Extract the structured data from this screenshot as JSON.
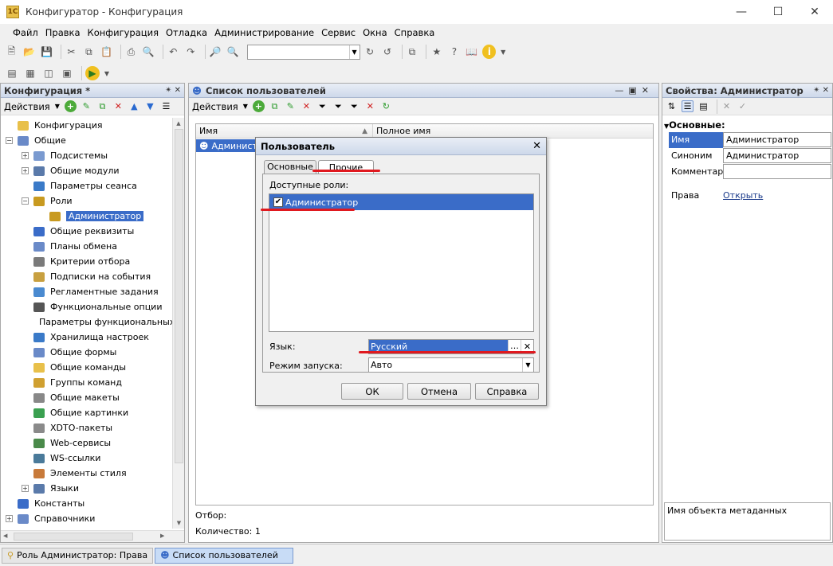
{
  "window": {
    "title": "Конфигуратор - Конфигурация"
  },
  "menu": [
    "Файл",
    "Правка",
    "Конфигурация",
    "Отладка",
    "Администрирование",
    "Сервис",
    "Окна",
    "Справка"
  ],
  "config_panel": {
    "title": "Конфигурация *",
    "actions_label": "Действия",
    "tree": [
      {
        "label": "Конфигурация",
        "level": 0,
        "icon": "config-icon"
      },
      {
        "label": "Общие",
        "level": 0,
        "icon": "common-icon",
        "expander": "−"
      },
      {
        "label": "Подсистемы",
        "level": 1,
        "icon": "subsystems-icon",
        "expander": "+"
      },
      {
        "label": "Общие модули",
        "level": 1,
        "icon": "modules-icon",
        "expander": "+"
      },
      {
        "label": "Параметры сеанса",
        "level": 1,
        "icon": "session-params-icon"
      },
      {
        "label": "Роли",
        "level": 1,
        "icon": "roles-icon",
        "expander": "−"
      },
      {
        "label": "Администратор",
        "level": 2,
        "icon": "role-icon",
        "selected": true
      },
      {
        "label": "Общие реквизиты",
        "level": 1,
        "icon": "attributes-icon"
      },
      {
        "label": "Планы обмена",
        "level": 1,
        "icon": "exchange-icon"
      },
      {
        "label": "Критерии отбора",
        "level": 1,
        "icon": "filter-icon"
      },
      {
        "label": "Подписки на события",
        "level": 1,
        "icon": "subscriptions-icon"
      },
      {
        "label": "Регламентные задания",
        "level": 1,
        "icon": "jobs-icon"
      },
      {
        "label": "Функциональные опции",
        "level": 1,
        "icon": "options-icon"
      },
      {
        "label": "Параметры функциональных",
        "level": 1,
        "icon": "option-params-icon"
      },
      {
        "label": "Хранилища настроек",
        "level": 1,
        "icon": "storage-icon"
      },
      {
        "label": "Общие формы",
        "level": 1,
        "icon": "forms-icon"
      },
      {
        "label": "Общие команды",
        "level": 1,
        "icon": "commands-icon"
      },
      {
        "label": "Группы команд",
        "level": 1,
        "icon": "command-groups-icon"
      },
      {
        "label": "Общие макеты",
        "level": 1,
        "icon": "templates-icon"
      },
      {
        "label": "Общие картинки",
        "level": 1,
        "icon": "pictures-icon"
      },
      {
        "label": "XDTO-пакеты",
        "level": 1,
        "icon": "xdto-icon"
      },
      {
        "label": "Web-сервисы",
        "level": 1,
        "icon": "web-services-icon"
      },
      {
        "label": "WS-ссылки",
        "level": 1,
        "icon": "ws-links-icon"
      },
      {
        "label": "Элементы стиля",
        "level": 1,
        "icon": "style-icon"
      },
      {
        "label": "Языки",
        "level": 1,
        "icon": "languages-icon",
        "expander": "+"
      },
      {
        "label": "Константы",
        "level": 0,
        "icon": "constants-icon"
      },
      {
        "label": "Справочники",
        "level": 0,
        "icon": "catalogs-icon",
        "expander": "+"
      }
    ]
  },
  "users_panel": {
    "title": "Список пользователей",
    "actions_label": "Действия",
    "col_name": "Имя",
    "col_fullname": "Полное имя",
    "row_name": "Администратор",
    "filter_label": "Отбор:",
    "count_label": "Количество: 1"
  },
  "dialog": {
    "title": "Пользователь",
    "tabs": [
      "Основные",
      "Прочие"
    ],
    "roles_label": "Доступные роли:",
    "role_item": "Администратор",
    "lang_label": "Язык:",
    "lang_value": "Русский",
    "mode_label": "Режим запуска:",
    "mode_value": "Авто",
    "ok": "ОК",
    "cancel": "Отмена",
    "help": "Справка"
  },
  "props_panel": {
    "title": "Свойства: Администратор",
    "section": "Основные:",
    "rows": [
      {
        "label": "Имя",
        "value": "Администратор"
      },
      {
        "label": "Синоним",
        "value": "Администратор"
      },
      {
        "label": "Комментари",
        "value": ""
      }
    ],
    "rights_label": "Права",
    "rights_link": "Открыть",
    "hint": "Имя объекта метаданных"
  },
  "taskbar": [
    "Роль Администратор: Права",
    "Список пользователей"
  ]
}
